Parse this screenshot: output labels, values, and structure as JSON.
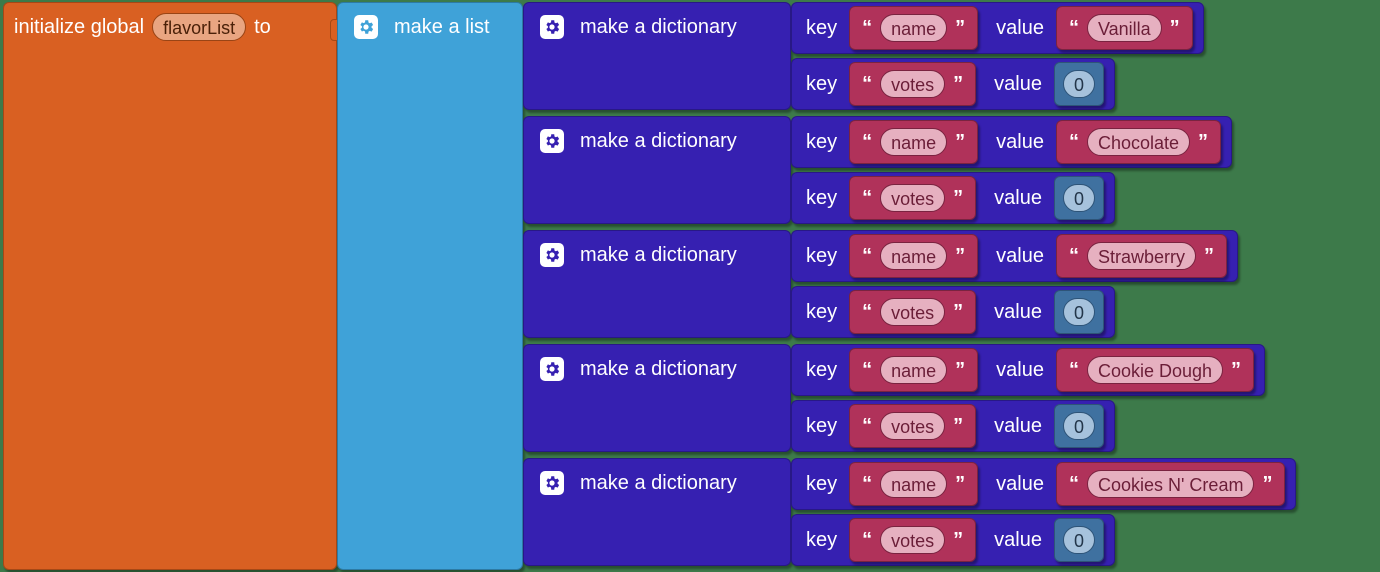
{
  "orange": {
    "initText": "initialize global",
    "varName": "flavorList",
    "toText": "to"
  },
  "cyan": {
    "gear": "gear-icon",
    "label": "make a list"
  },
  "dict": {
    "gear": "gear-icon",
    "label": "make a dictionary"
  },
  "rowLabels": {
    "key": "key",
    "value": "value"
  },
  "items": [
    {
      "nameKey": "name",
      "nameVal": "Vanilla",
      "votesKey": "votes",
      "votesVal": "0"
    },
    {
      "nameKey": "name",
      "nameVal": "Chocolate",
      "votesKey": "votes",
      "votesVal": "0"
    },
    {
      "nameKey": "name",
      "nameVal": "Strawberry",
      "votesKey": "votes",
      "votesVal": "0"
    },
    {
      "nameKey": "name",
      "nameVal": "Cookie Dough",
      "votesKey": "votes",
      "votesVal": "0"
    },
    {
      "nameKey": "name",
      "nameVal": "Cookies N' Cream",
      "votesKey": "votes",
      "votesVal": "0"
    }
  ]
}
